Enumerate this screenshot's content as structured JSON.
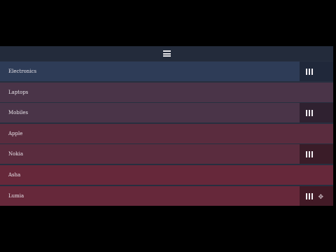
{
  "menu": {
    "icon": "hamburger-menu-icon"
  },
  "list": {
    "items": [
      {
        "label": "Electronics",
        "color": "#2e3c57",
        "draggable": true,
        "handle_color": "#20283a"
      },
      {
        "label": "Laptops",
        "color": "#4a3448",
        "draggable": false
      },
      {
        "label": "Mobiles",
        "color": "#4a3448",
        "draggable": true,
        "handle_color": "#2f2130"
      },
      {
        "label": "Apple",
        "color": "#5a2c3e",
        "draggable": false
      },
      {
        "label": "Nokia",
        "color": "#5a2c3e",
        "draggable": true,
        "handle_color": "#3a1c28"
      },
      {
        "label": "Asha",
        "color": "#66283a",
        "draggable": false
      },
      {
        "label": "Lumia",
        "color": "#66283a",
        "draggable": true,
        "handle_color": "#421a26"
      }
    ],
    "handle_icon": "drag-handle-bars-icon",
    "cursor_icon": "move-cursor-icon"
  }
}
